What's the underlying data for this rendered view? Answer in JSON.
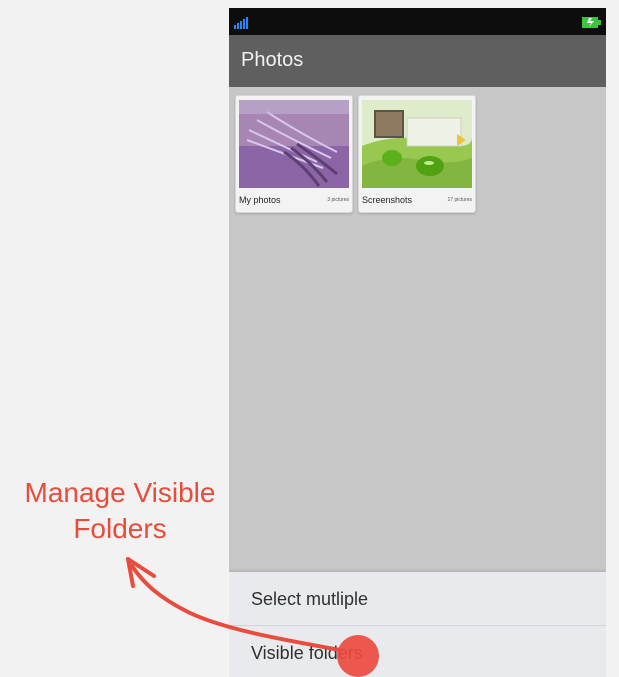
{
  "status_bar": {
    "signal_icon": "signal-icon",
    "battery_icon": "battery-icon"
  },
  "app_bar": {
    "title": "Photos"
  },
  "albums": [
    {
      "name": "My photos",
      "count": "3 pictures",
      "thumbnail_icon": "lavender-photo-thumbnail"
    },
    {
      "name": "Screenshots",
      "count": "17 pictures",
      "thumbnail_icon": "screenshot-photo-thumbnail"
    }
  ],
  "menu": {
    "items": [
      {
        "label": "Select mutliple"
      },
      {
        "label": "Visible folders"
      }
    ]
  },
  "annotation": {
    "line1": "Manage Visible",
    "line2": "Folders"
  },
  "colors": {
    "annotation": "#e74c3c",
    "app_bar": "#5f5f5f",
    "menu_bg": "#e9eaee",
    "phone_bg": "#c7c7c7",
    "tap_indicator": "#ec4a40"
  }
}
